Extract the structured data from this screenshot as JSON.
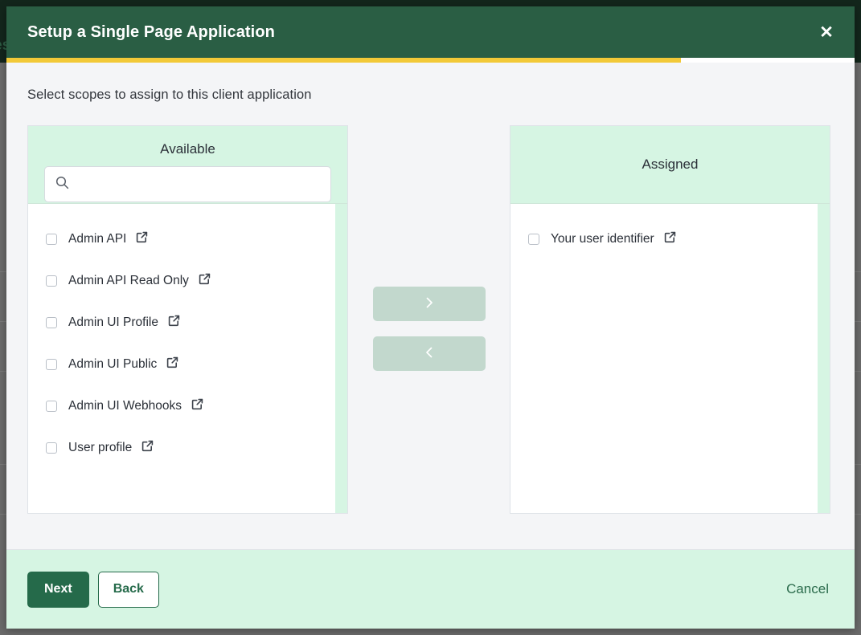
{
  "background": {
    "header_text": "es"
  },
  "dialog": {
    "title": "Setup a Single Page Application",
    "close_label": "✕",
    "progress_percent": 79.5,
    "progress_color": "#f2c938",
    "header_color": "#2a5e44",
    "instruction": "Select scopes to assign to this client application"
  },
  "available_panel": {
    "title": "Available",
    "search": {
      "value": "",
      "placeholder": ""
    },
    "items": [
      {
        "label": "Admin API",
        "checked": false
      },
      {
        "label": "Admin API Read Only",
        "checked": false
      },
      {
        "label": "Admin UI Profile",
        "checked": false
      },
      {
        "label": "Admin UI Public",
        "checked": false
      },
      {
        "label": "Admin UI Webhooks",
        "checked": false
      },
      {
        "label": "User profile",
        "checked": false
      }
    ]
  },
  "assigned_panel": {
    "title": "Assigned",
    "items": [
      {
        "label": "Your user identifier",
        "checked": false
      }
    ]
  },
  "transfer": {
    "add_label": "›",
    "remove_label": "‹",
    "disabled_color": "#c2d8cd"
  },
  "footer": {
    "next_label": "Next",
    "back_label": "Back",
    "cancel_label": "Cancel",
    "accent_color": "#256a4a",
    "background_color": "#d6f5e3"
  }
}
